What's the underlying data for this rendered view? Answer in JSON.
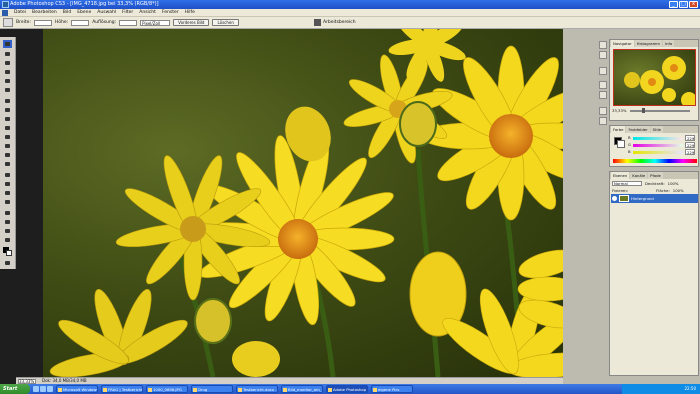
{
  "window": {
    "title": "Adobe Photoshop CS3 - [IMG_4718.jpg bei 33,3% (RGB/8*)]",
    "minimize": "_",
    "maximize": "□",
    "close": "x"
  },
  "menu": [
    "Datei",
    "Bearbeiten",
    "Bild",
    "Ebene",
    "Auswahl",
    "Filter",
    "Ansicht",
    "Fenster",
    "Hilfe"
  ],
  "options": {
    "width_label": "Breite:",
    "height_label": "Höhe:",
    "resolution_label": "Auflösung:",
    "unit": "Pixel/Zoll",
    "front_image_btn": "Vorderes Bild",
    "clear_btn": "Löschen",
    "workspace": "Arbeitsbereich"
  },
  "status": {
    "zoom": "33,33%",
    "doc": "Dok: 34,0 MB/34,0 MB"
  },
  "panels": {
    "navigator_tabs": [
      "Navigator",
      "Histogramm",
      "Info"
    ],
    "navigator_zoom": "33,33%",
    "color_tabs": [
      "Farbe",
      "Farbfelder",
      "Stile"
    ],
    "rgb": [
      {
        "label": "R",
        "value": "229"
      },
      {
        "label": "G",
        "value": "229"
      },
      {
        "label": "B",
        "value": "229"
      }
    ],
    "layers_tabs": [
      "Ebenen",
      "Kanäle",
      "Pfade"
    ],
    "blend_mode": "Normal",
    "opacity_label": "Deckkraft:",
    "opacity": "100%",
    "lock_label": "Fixieren:",
    "fill_label": "Fläche:",
    "fill": "100%",
    "layer_name": "Hintergrund"
  },
  "taskbar": {
    "start": "Start",
    "tasks": [
      "Microsoft Windows",
      "FRAG | Testbericht d...",
      "1000_0698.JPG",
      "Drug",
      "Testbericht.docx - Mi...",
      "Bild_monitor_am_...",
      "Adobe Photoshop CS3 ...",
      "eigene Pics"
    ],
    "clock": "22:50"
  },
  "colors": {
    "accent": "#316ac5",
    "flower": "#f2dc1e",
    "flower_center": "#e8901a",
    "background": "#3f4c14"
  }
}
